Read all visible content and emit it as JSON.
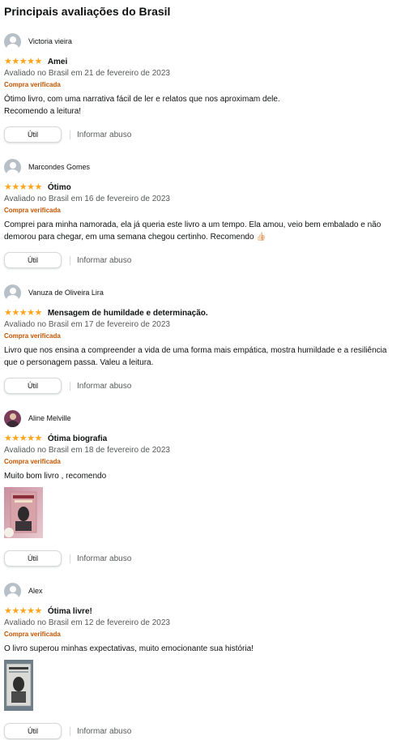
{
  "section_title": "Principais avaliações do Brasil",
  "useful_label": "Útil",
  "abuse_label": "Informar abuso",
  "colors": {
    "star": "#ffa41c",
    "verified": "#c45500",
    "meta": "#565959"
  },
  "reviews": [
    {
      "name": "Victoria vieira",
      "stars": "★★★★★",
      "rating": 5,
      "title": "Amei",
      "date": "Avaliado no Brasil em 21 de fevereiro de 2023",
      "verified": "Compra verificada",
      "body": "Ótimo livro, com uma narrativa fácil de ler e relatos que nos aproximam dele.\nRecomendo a leitura!"
    },
    {
      "name": "Marcondes Gomes",
      "stars": "★★★★★",
      "rating": 5,
      "title": "Ótimo",
      "date": "Avaliado no Brasil em 16 de fevereiro de 2023",
      "verified": "Compra verificada",
      "body": "Comprei para minha namorada, ela já queria este livro a um tempo. Ela amou, veio bem embalado e não demorou para chegar, em uma semana chegou certinho. Recomendo 👍🏻"
    },
    {
      "name": "Vanuza de Oliveira Lira",
      "stars": "★★★★★",
      "rating": 5,
      "title": "Mensagem de humildade e determinação.",
      "date": "Avaliado no Brasil em 17 de fevereiro de 2023",
      "verified": "Compra verificada",
      "body": "Livro que nos ensina a compreender a vida de uma forma mais empática, mostra humildade e a resiliência que o personagem passa. Valeu a leitura."
    },
    {
      "name": "Aline Melville",
      "stars": "★★★★★",
      "rating": 5,
      "title": "Ótima biografia",
      "date": "Avaliado no Brasil em 18 de fevereiro de 2023",
      "verified": "Compra verificada",
      "body": "Muito bom livro , recomendo"
    },
    {
      "name": "Alex",
      "stars": "★★★★★",
      "rating": 5,
      "title": "Ótima livre!",
      "date": "Avaliado no Brasil em 12 de fevereiro de 2023",
      "verified": "Compra verificada",
      "body": "O livro superou minhas expectativas, muito emocionante sua história!"
    }
  ]
}
